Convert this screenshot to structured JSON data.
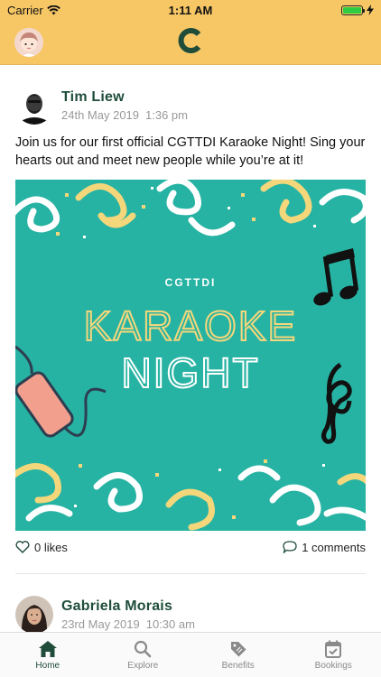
{
  "status_bar": {
    "carrier": "Carrier",
    "time": "1:11 AM",
    "battery_level": 1.0
  },
  "nav": {
    "avatar_icon": "user-avatar-icon",
    "logo_icon": "c-logo-icon",
    "brand_color": "#1f4d3a",
    "bar_color": "#f7c766"
  },
  "posts": [
    {
      "author": "Tim Liew",
      "date": "24th May 2019",
      "time": "1:36 pm",
      "text": "Join us for our first official CGTTDI Karaoke Night! Sing your hearts out and meet new people while you’re at it!",
      "image": {
        "tag": "CGTTDI",
        "title_line1": "KARAOKE",
        "title_line2": "NIGHT",
        "bg_color": "#27b3a3"
      },
      "likes": "0 likes",
      "comments": "1 comments"
    },
    {
      "author": "Gabriela Morais",
      "date": "23rd May 2019",
      "time": "10:30 am"
    }
  ],
  "tabs": [
    {
      "label": "Home",
      "icon": "home-icon",
      "active": true
    },
    {
      "label": "Explore",
      "icon": "search-icon",
      "active": false
    },
    {
      "label": "Benefits",
      "icon": "tag-icon",
      "active": false
    },
    {
      "label": "Bookings",
      "icon": "calendar-check-icon",
      "active": false
    }
  ]
}
